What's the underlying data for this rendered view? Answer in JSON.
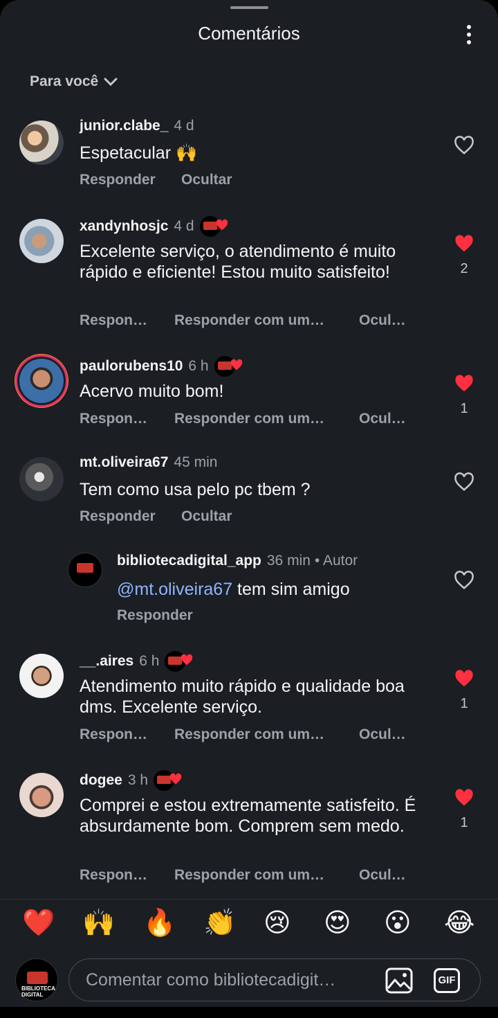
{
  "header": {
    "title": "Comentários"
  },
  "sort": {
    "label": "Para você"
  },
  "comments": [
    {
      "user": "junior.clabe_",
      "time": "4 d",
      "text": "Espetacular 🙌",
      "actions": [
        "Responder",
        "Ocultar"
      ],
      "likes": ""
    },
    {
      "user": "xandynhosjc",
      "time": "4 d",
      "text": "Excelente serviço, o atendimento é muito rápido e eficiente! Estou muito satisfeito!",
      "actions": [
        "Respon…",
        "Responder com um…",
        "Ocul…"
      ],
      "likes": "2"
    },
    {
      "user": "paulorubens10",
      "time": "6 h",
      "text": "Acervo muito bom!",
      "actions": [
        "Respon…",
        "Responder com um…",
        "Ocul…"
      ],
      "likes": "1"
    },
    {
      "user": "mt.oliveira67",
      "time": "45 min",
      "text": "Tem como usa pelo pc tbem ?",
      "actions": [
        "Responder",
        "Ocultar"
      ],
      "likes": ""
    },
    {
      "user": "bibliotecadigital_app",
      "time": "36 min",
      "author": "• Autor",
      "mention": "@mt.oliveira67",
      "text": " tem sim amigo",
      "actions": [
        "Responder"
      ],
      "likes": ""
    },
    {
      "user": "__.aires",
      "time": "6 h",
      "text": "Atendimento muito rápido e qualidade boa dms. Excelente serviço.",
      "actions": [
        "Respon…",
        "Responder com um…",
        "Ocul…"
      ],
      "likes": "1"
    },
    {
      "user": "dogee",
      "time": "3 h",
      "text": "Comprei e estou extremamente satisfeito. É absurdamente bom. Comprem sem medo.",
      "actions": [
        "Respon…",
        "Responder com um…",
        "Ocul…"
      ],
      "likes": "1"
    }
  ],
  "emoji_bar": [
    "❤️",
    "🙌",
    "🔥",
    "👏",
    "😢",
    "😍",
    "😮",
    "😂"
  ],
  "composer": {
    "placeholder": "Comentar como bibliotecadigit…",
    "gif_label": "GIF",
    "avatar_text": "BIBLIOTECA DIGITAL"
  },
  "colors": {
    "background": "#1b1e23",
    "heart_red": "#ff3040",
    "mention": "#8fb6ff",
    "muted": "#9ea1a7"
  }
}
